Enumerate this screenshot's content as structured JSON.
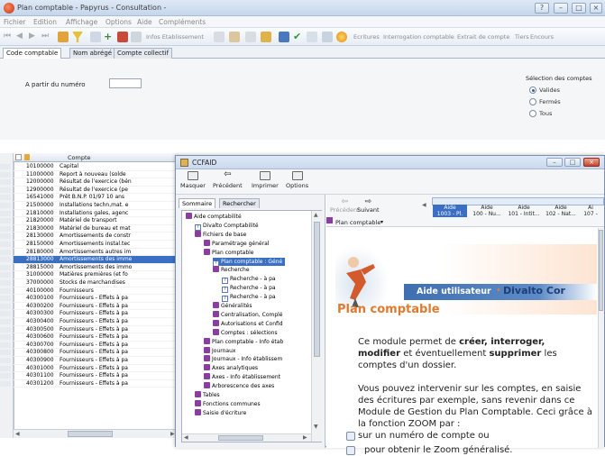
{
  "window": {
    "title": "Plan comptable - Papyrus - Consultation -"
  },
  "menu": [
    "Fichier",
    "Edition",
    "Affichage",
    "Options",
    "Aide",
    "Compléments"
  ],
  "toolbar": {
    "labels": [
      "Infos Etablissement",
      "Ecritures",
      "Interrogation comptable",
      "Extrait de compte",
      "Tiers",
      "Encours"
    ]
  },
  "tabs": [
    "Code comptable",
    "Nom abrégé",
    "Compte collectif"
  ],
  "search": {
    "from_label": "A partir du numéro",
    "selection_title": "Sélection des comptes",
    "options": [
      "Valides",
      "Fermés",
      "Tous"
    ]
  },
  "grid": {
    "header": {
      "col1": "Compte"
    },
    "rows": [
      {
        "num": "10100000",
        "lib": "Capital"
      },
      {
        "num": "11000000",
        "lib": "Report à nouveau (solde"
      },
      {
        "num": "12000000",
        "lib": "Résultat de l'exercice (bén"
      },
      {
        "num": "12900000",
        "lib": "Résultat de l'exercice (pe"
      },
      {
        "num": "16541000",
        "lib": "Prêt B.N.P. 01/97 10 ans"
      },
      {
        "num": "21500000",
        "lib": "Installations techn,mat. e"
      },
      {
        "num": "21810000",
        "lib": "Installations gales, agenc"
      },
      {
        "num": "21820000",
        "lib": "Matériel de transport"
      },
      {
        "num": "21830000",
        "lib": "Matériel de bureau et mat"
      },
      {
        "num": "28130000",
        "lib": "Amortissements de constr"
      },
      {
        "num": "28150000",
        "lib": "Amortissements instal.tec"
      },
      {
        "num": "28180000",
        "lib": "Amortissements autres im"
      },
      {
        "num": "28813000",
        "lib": "Amortissements des imme"
      },
      {
        "num": "28815000",
        "lib": "Amortissements des immo"
      },
      {
        "num": "31000000",
        "lib": "Matières premières (et fo"
      },
      {
        "num": "37000000",
        "lib": "Stocks de marchandises"
      },
      {
        "num": "40100000",
        "lib": "Fournisseurs"
      },
      {
        "num": "40300100",
        "lib": "Fournisseurs - Effets à pa"
      },
      {
        "num": "40300200",
        "lib": "Fournisseurs - Effets à pa"
      },
      {
        "num": "40300300",
        "lib": "Fournisseurs - Effets à pa"
      },
      {
        "num": "40300400",
        "lib": "Fournisseurs - Effets à pa"
      },
      {
        "num": "40300500",
        "lib": "Fournisseurs - Effets à pa"
      },
      {
        "num": "40300600",
        "lib": "Fournisseurs - Effets à pa"
      },
      {
        "num": "40300700",
        "lib": "Fournisseurs - Effets à pa"
      },
      {
        "num": "40300800",
        "lib": "Fournisseurs - Effets à pa"
      },
      {
        "num": "40300900",
        "lib": "Fournisseurs - Effets à pa"
      },
      {
        "num": "40301000",
        "lib": "Fournisseurs - Effets à pa"
      },
      {
        "num": "40301100",
        "lib": "Fournisseurs - Effets à pa"
      },
      {
        "num": "40301200",
        "lib": "Fournisseurs - Effets à pa"
      }
    ],
    "selected_index": 12
  },
  "help": {
    "title": "CCFAID",
    "toolbar": [
      "Masquer",
      "Précédent",
      "Imprimer",
      "Options"
    ],
    "left_tabs": [
      "Sommaire",
      "Rechercher"
    ],
    "tree": [
      {
        "label": "Aide comptabilité",
        "depth": 0,
        "icon": "book"
      },
      {
        "label": "Divalto Comptabilité",
        "depth": 1,
        "icon": "qm"
      },
      {
        "label": "Fichiers de base",
        "depth": 1,
        "icon": "book"
      },
      {
        "label": "Paramétrage général",
        "depth": 2,
        "icon": "book"
      },
      {
        "label": "Plan comptable",
        "depth": 2,
        "icon": "book"
      },
      {
        "label": "Plan comptable : Géné",
        "depth": 3,
        "icon": "qm",
        "selected": true
      },
      {
        "label": "Recherche",
        "depth": 3,
        "icon": "book"
      },
      {
        "label": "Recherche - à pa",
        "depth": 4,
        "icon": "qm"
      },
      {
        "label": "Recherche - à pa",
        "depth": 4,
        "icon": "qm"
      },
      {
        "label": "Recherche - à pa",
        "depth": 4,
        "icon": "qm"
      },
      {
        "label": "Généralités",
        "depth": 3,
        "icon": "book"
      },
      {
        "label": "Centralisation, Complé",
        "depth": 3,
        "icon": "book"
      },
      {
        "label": "Autorisations et Confid",
        "depth": 3,
        "icon": "book"
      },
      {
        "label": "Comptes : sélections",
        "depth": 3,
        "icon": "book"
      },
      {
        "label": "Plan comptable - Info étab",
        "depth": 2,
        "icon": "book"
      },
      {
        "label": "Journaux",
        "depth": 2,
        "icon": "book"
      },
      {
        "label": "Journaux - Info établissem",
        "depth": 2,
        "icon": "book"
      },
      {
        "label": "Axes analytiques",
        "depth": 2,
        "icon": "book"
      },
      {
        "label": "Axes - Info établissement",
        "depth": 2,
        "icon": "book"
      },
      {
        "label": "Arborescence des axes",
        "depth": 2,
        "icon": "book"
      },
      {
        "label": "Tables",
        "depth": 1,
        "icon": "book"
      },
      {
        "label": "Fonctions communes",
        "depth": 1,
        "icon": "book"
      },
      {
        "label": "Saisie d'écriture",
        "depth": 1,
        "icon": "book"
      }
    ],
    "nav": {
      "prev": "Précédent",
      "next": "Suivant",
      "topic_nodes": [
        {
          "line1": "Aide",
          "line2": "1003 - Pl."
        },
        {
          "line1": "Aide",
          "line2": "100 - Nu..."
        },
        {
          "line1": "Aide",
          "line2": "101 - Intit..."
        },
        {
          "line1": "Aide",
          "line2": "102 - Nat..."
        },
        {
          "line1": "Ai",
          "line2": "107 -"
        }
      ],
      "plan_label": "Plan comptable"
    },
    "banner": {
      "text": "Aide utilisateur",
      "brand": "Divalto Cor"
    },
    "page_title": "Plan comptable",
    "para1": {
      "p1": "Ce module permet de ",
      "b1": "créer, interroger,",
      "b2": "modifier",
      "p2": " et éventuellement ",
      "b3": "supprimer",
      "p3": " les comptes d'un dossier."
    },
    "para2": "Vous pouvez intervenir sur les comptes, en saisie des écritures par exemple, sans revenir dans ce Module de Gestion du Plan Comptable. Ceci grâce à la fonction ZOOM par :",
    "zoom1": "sur un numéro de compte ou",
    "zoom2": "pour obtenir le Zoom généralisé."
  }
}
